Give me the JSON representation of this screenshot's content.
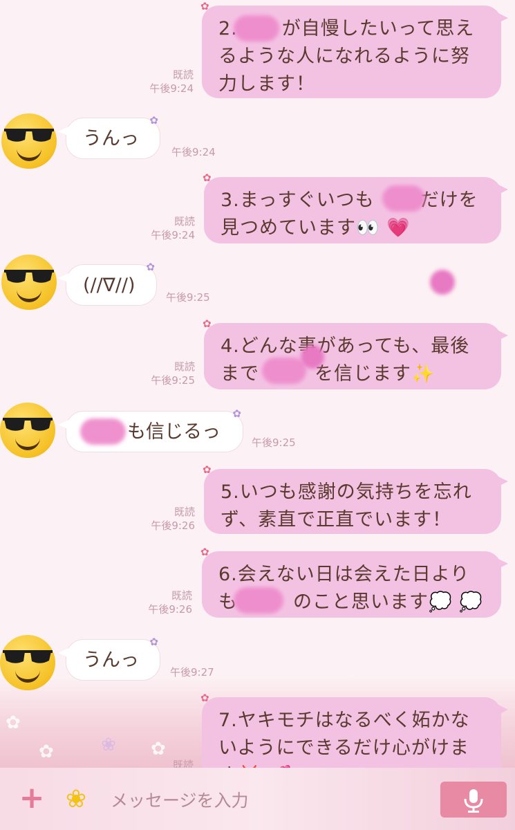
{
  "messages": [
    {
      "side": "me",
      "text_l1": "2.",
      "text_l1b": "が自慢したいって思え",
      "text_l2": "るような人になれるように努",
      "text_l3": "力します！",
      "read": "既読",
      "time": "午後9:24"
    },
    {
      "side": "you",
      "text": "うんっ",
      "time": "午後9:24"
    },
    {
      "side": "me",
      "text_l1a": "3.まっすぐいつも",
      "text_l1b": "だけを",
      "text_l2": "見つめています",
      "emoji_l2": "👀 💗",
      "read": "既読",
      "time": "午後9:24"
    },
    {
      "side": "you",
      "text": "(//∇//)",
      "time": "午後9:25"
    },
    {
      "side": "me",
      "text_l1": "4.どんな事があっても、最後",
      "text_l2a": "まで",
      "text_l2b": "を信じます",
      "emoji_l2": "✨",
      "read": "既読",
      "time": "午後9:25"
    },
    {
      "side": "you",
      "text": "も信じるっ",
      "time": "午後9:25"
    },
    {
      "side": "me",
      "text_l1": "5.いつも感謝の気持ちを忘れ",
      "text_l2": "ず、素直で正直でいます！",
      "read": "既読",
      "time": "午後9:26"
    },
    {
      "side": "me",
      "text_l1": "6.会えない日は会えた日より",
      "text_l2a": "も",
      "text_l2b": "のこと思います",
      "emoji_l2": "💭 💭",
      "read": "既読",
      "time": "午後9:26"
    },
    {
      "side": "you",
      "text": "うんっ",
      "time": "午後9:27"
    },
    {
      "side": "me",
      "text_l1": "7.ヤキモチはなるべく妬かな",
      "text_l2": "いようにできるだけ心がけま",
      "text_l3": "す",
      "emoji_l3": "💢 💕",
      "read": "既読"
    }
  ],
  "input_bar": {
    "add_icon": "plus-icon",
    "sticker_icon": "flower-icon",
    "placeholder": "メッセージを入力",
    "mic_icon": "microphone-icon"
  },
  "colors": {
    "my_bubble": "#f3c2e3",
    "their_bubble": "#ffffff",
    "background": "#fcf1f4",
    "accent": "#e98aa5",
    "meta_text": "#c69aa9"
  }
}
